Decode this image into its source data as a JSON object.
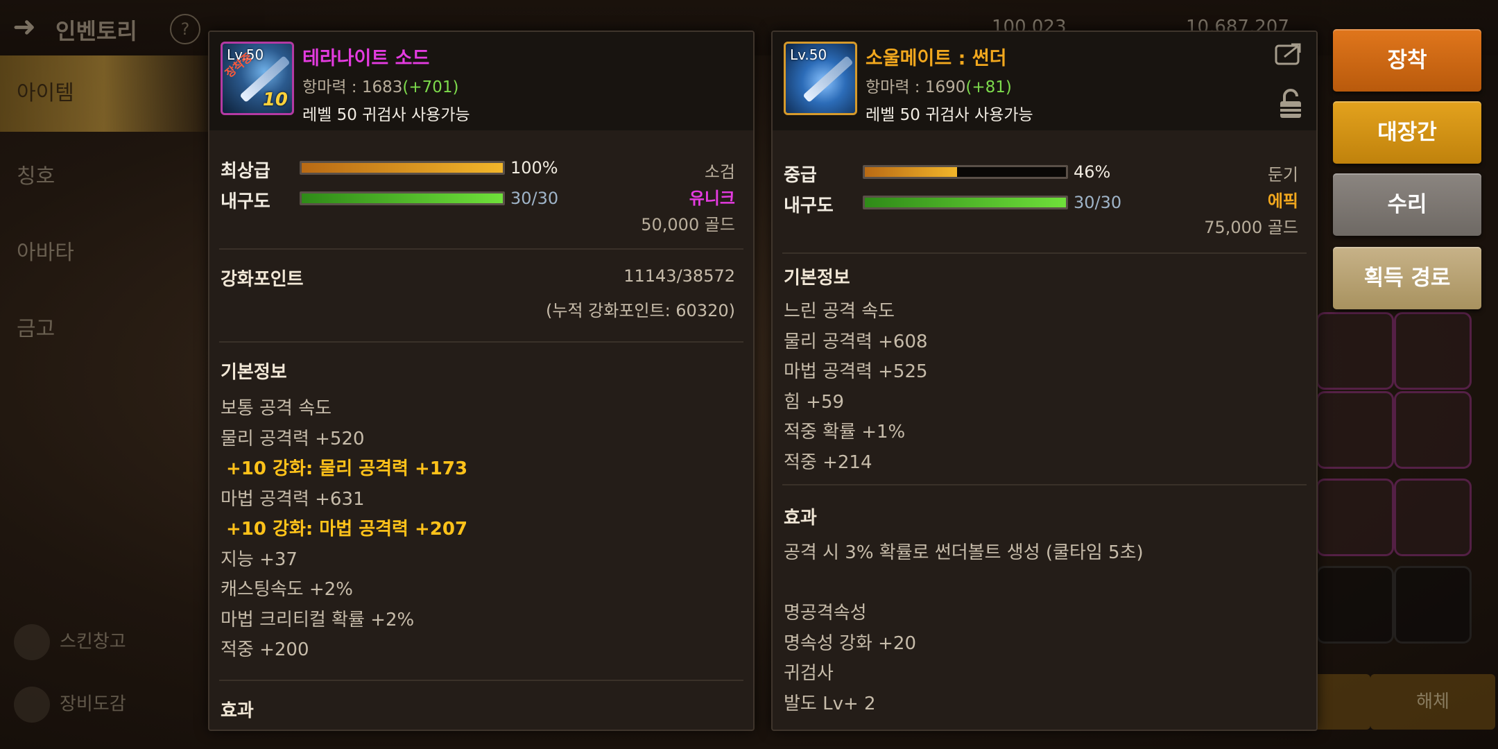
{
  "background": {
    "title": "인벤토리",
    "help": "?",
    "currency": [
      "100,023",
      "10,687,207"
    ],
    "sidebar": [
      "아이템",
      "칭호",
      "아바타",
      "금고"
    ],
    "sidebar_bottom": [
      "스킨창고",
      "장비도감"
    ],
    "bottom_buttons": [
      "해체"
    ]
  },
  "left_item": {
    "level_badge": "Lv.50",
    "equipped_tag": "장착중",
    "enhance_badge": "10",
    "name": "테라나이트 소드",
    "name_color": "#e43be0",
    "power_label": "항마력 : 1683",
    "power_bonus": "(+701)",
    "requirement": "레벨 50 귀검사 사용가능",
    "grade_label": "최상급",
    "grade_percent": 1.0,
    "grade_value": "100%",
    "durability_label": "내구도",
    "durability_fraction": 1.0,
    "durability_value": "30/30",
    "weapon_type": "소검",
    "rarity": "유니크",
    "rarity_color": "#e43be0",
    "price": "50,000 골드",
    "enhance_points_label": "강화포인트",
    "enhance_points_value": "11143/38572",
    "enhance_points_total": "(누적 강화포인트: 60320)",
    "basic_info_title": "기본정보",
    "stats": [
      {
        "text": "보통 공격 속도",
        "enh": false
      },
      {
        "text": "물리 공격력 +520",
        "enh": false
      },
      {
        "text": "+10 강화: 물리 공격력 +173",
        "enh": true
      },
      {
        "text": "마법 공격력 +631",
        "enh": false
      },
      {
        "text": "+10 강화: 마법 공격력 +207",
        "enh": true
      },
      {
        "text": "지능 +37",
        "enh": false
      },
      {
        "text": "캐스팅속도 +2%",
        "enh": false
      },
      {
        "text": "마법 크리티컬 확률 +2%",
        "enh": false
      },
      {
        "text": "적중 +200",
        "enh": false
      }
    ],
    "next_section_title": "효과"
  },
  "right_item": {
    "level_badge": "Lv.50",
    "name": "소울메이트 : 썬더",
    "name_color": "#f2a81e",
    "power_label": "항마력 : 1690",
    "power_bonus": "(+81)",
    "requirement": "레벨 50 귀검사 사용가능",
    "share_icon": "share-icon",
    "lock_icon": "lock-icon",
    "grade_label": "중급",
    "grade_percent": 0.46,
    "grade_value": "46%",
    "durability_label": "내구도",
    "durability_fraction": 1.0,
    "durability_value": "30/30",
    "weapon_type": "둔기",
    "rarity": "에픽",
    "rarity_color": "#f2a81e",
    "price": "75,000 골드",
    "basic_info_title": "기본정보",
    "stats": [
      "느린 공격 속도",
      "물리 공격력 +608",
      "마법 공격력 +525",
      "힘 +59",
      "적중 확률 +1%",
      "적중 +214"
    ],
    "effect_title": "효과",
    "effects": [
      "공격 시 3% 확률로 썬더볼트 생성 (쿨타임 5초)",
      "",
      "명공격속성",
      "명속성 강화 +20",
      "귀검사",
      "발도 Lv+ 2"
    ]
  },
  "actions": {
    "equip": "장착",
    "blacksmith": "대장간",
    "repair": "수리",
    "obtain_route": "획득 경로"
  }
}
